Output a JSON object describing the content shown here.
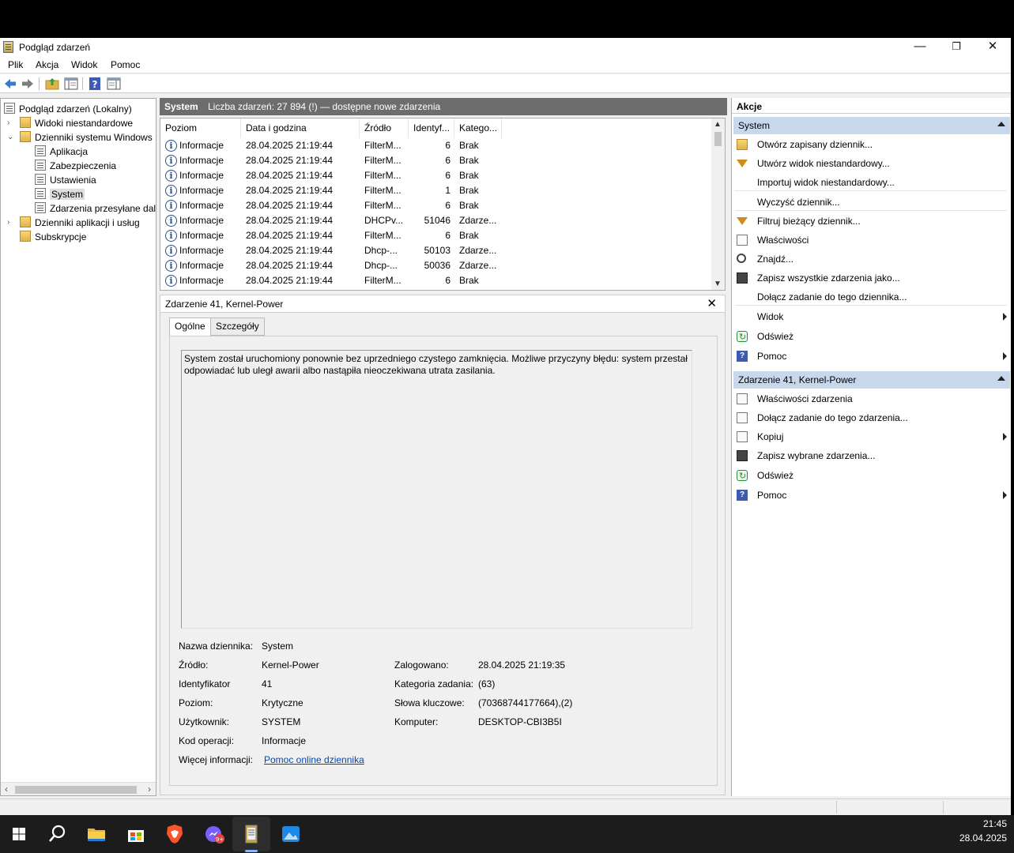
{
  "window": {
    "title": "Podgląd zdarzeń",
    "minimize_glyph": "—",
    "restore_glyph": "❐",
    "close_glyph": "✕"
  },
  "menu": [
    "Plik",
    "Akcja",
    "Widok",
    "Pomoc"
  ],
  "tree": {
    "root": "Podgląd zdarzeń (Lokalny)",
    "custom_views": "Widoki niestandardowe",
    "windows_logs": "Dzienniki systemu Windows",
    "logs": [
      "Aplikacja",
      "Zabezpieczenia",
      "Ustawienia",
      "System",
      "Zdarzenia przesyłane dalej"
    ],
    "app_logs": "Dzienniki aplikacji i usług",
    "subscriptions": "Subskrypcje",
    "selected": "System"
  },
  "list_header": {
    "name": "System",
    "count": "Liczba zdarzeń: 27 894 (!) — dostępne nowe zdarzenia"
  },
  "columns": [
    "Poziom",
    "Data i godzina",
    "Źródło",
    "Identyf...",
    "Katego..."
  ],
  "events": [
    {
      "level": "Informacje",
      "date": "28.04.2025 21:19:44",
      "source": "FilterM...",
      "id": "6",
      "category": "Brak"
    },
    {
      "level": "Informacje",
      "date": "28.04.2025 21:19:44",
      "source": "FilterM...",
      "id": "6",
      "category": "Brak"
    },
    {
      "level": "Informacje",
      "date": "28.04.2025 21:19:44",
      "source": "FilterM...",
      "id": "6",
      "category": "Brak"
    },
    {
      "level": "Informacje",
      "date": "28.04.2025 21:19:44",
      "source": "FilterM...",
      "id": "1",
      "category": "Brak"
    },
    {
      "level": "Informacje",
      "date": "28.04.2025 21:19:44",
      "source": "FilterM...",
      "id": "6",
      "category": "Brak"
    },
    {
      "level": "Informacje",
      "date": "28.04.2025 21:19:44",
      "source": "DHCPv...",
      "id": "51046",
      "category": "Zdarze..."
    },
    {
      "level": "Informacje",
      "date": "28.04.2025 21:19:44",
      "source": "FilterM...",
      "id": "6",
      "category": "Brak"
    },
    {
      "level": "Informacje",
      "date": "28.04.2025 21:19:44",
      "source": "Dhcp-...",
      "id": "50103",
      "category": "Zdarze..."
    },
    {
      "level": "Informacje",
      "date": "28.04.2025 21:19:44",
      "source": "Dhcp-...",
      "id": "50036",
      "category": "Zdarze..."
    },
    {
      "level": "Informacje",
      "date": "28.04.2025 21:19:44",
      "source": "FilterM...",
      "id": "6",
      "category": "Brak"
    }
  ],
  "detail": {
    "title": "Zdarzenie 41, Kernel-Power",
    "tabs": [
      "Ogólne",
      "Szczegóły"
    ],
    "description": "System został uruchomiony ponownie bez uprzedniego czystego zamknięcia. Możliwe przyczyny błędu: system przestał odpowiadać lub uległ awarii albo nastąpiła nieoczekiwana utrata zasilania.",
    "props": {
      "log_name_label": "Nazwa dziennika:",
      "log_name": "System",
      "source_label": "Źródło:",
      "source": "Kernel-Power",
      "logged_label": "Zalogowano:",
      "logged": "28.04.2025 21:19:35",
      "id_label": "Identyfikator",
      "id": "41",
      "task_label": "Kategoria zadania:",
      "task": "(63)",
      "level_label": "Poziom:",
      "level": "Krytyczne",
      "keywords_label": "Słowa kluczowe:",
      "keywords": "(70368744177664),(2)",
      "user_label": "Użytkownik:",
      "user": "SYSTEM",
      "computer_label": "Komputer:",
      "computer": "DESKTOP-CBI3B5I",
      "opcode_label": "Kod operacji:",
      "opcode": "Informacje",
      "more_label": "Więcej informacji:",
      "more_link": "Pomoc online dziennika"
    }
  },
  "actions": {
    "title": "Akcje",
    "section1": "System",
    "section1_items": [
      "Otwórz zapisany dziennik...",
      "Utwórz widok niestandardowy...",
      "Importuj widok niestandardowy...",
      "Wyczyść dziennik...",
      "Filtruj bieżący dziennik...",
      "Właściwości",
      "Znajdź...",
      "Zapisz wszystkie zdarzenia jako...",
      "Dołącz zadanie do tego dziennika...",
      "Widok",
      "Odśwież",
      "Pomoc"
    ],
    "section2": "Zdarzenie 41, Kernel-Power",
    "section2_items": [
      "Właściwości zdarzenia",
      "Dołącz zadanie do tego zdarzenia...",
      "Kopiuj",
      "Zapisz wybrane zdarzenia...",
      "Odśwież",
      "Pomoc"
    ]
  },
  "taskbar": {
    "time": "21:45",
    "date": "28.04.2025",
    "badge": "9+"
  },
  "colors": {
    "accent": "#c8d8ec",
    "header_bar": "#6d6d6d",
    "taskbar": "#1c1c1c",
    "link": "#0645ad"
  }
}
